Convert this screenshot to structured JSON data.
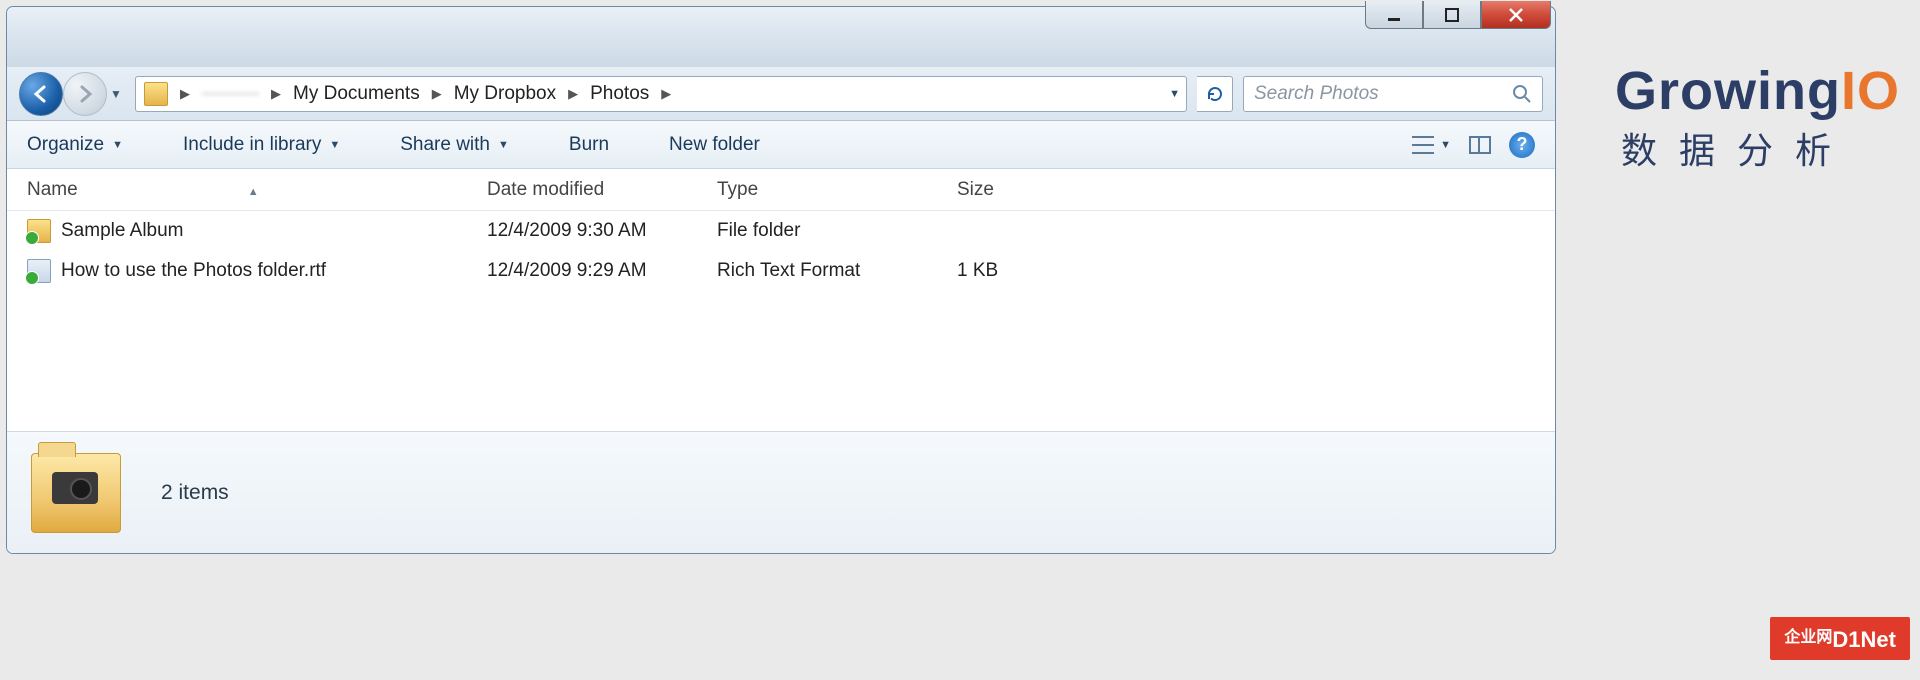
{
  "breadcrumb": {
    "root_blur": "———",
    "c1": "My Documents",
    "c2": "My Dropbox",
    "c3": "Photos"
  },
  "search": {
    "placeholder": "Search Photos"
  },
  "toolbar": {
    "organize": "Organize",
    "include": "Include in library",
    "share": "Share with",
    "burn": "Burn",
    "newfolder": "New folder"
  },
  "columns": {
    "name": "Name",
    "date": "Date modified",
    "type": "Type",
    "size": "Size"
  },
  "rows": [
    {
      "name": "Sample Album",
      "date": "12/4/2009 9:30 AM",
      "type": "File folder",
      "size": "",
      "icon": "folder"
    },
    {
      "name": "How to use the Photos folder.rtf",
      "date": "12/4/2009 9:29 AM",
      "type": "Rich Text Format",
      "size": "1 KB",
      "icon": "file"
    }
  ],
  "details": {
    "count": "2 items"
  },
  "watermark": {
    "brand_part1": "Growing",
    "brand_part2": "IO",
    "brand_sub": "数据分析",
    "corner_cn": "企业网",
    "corner_en": "D1Net"
  }
}
